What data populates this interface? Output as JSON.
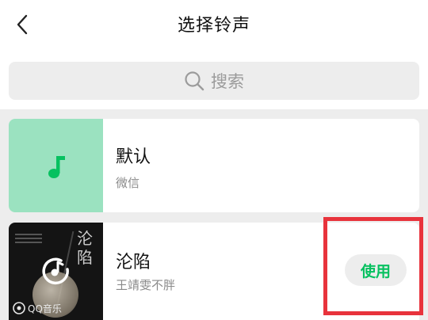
{
  "header": {
    "title": "选择铃声",
    "back_icon": "chevron-left-icon"
  },
  "search": {
    "placeholder": "搜索",
    "icon": "search-icon"
  },
  "ringtones": [
    {
      "name": "默认",
      "source": "微信",
      "thumb_color": "#9be2c0",
      "icon": "music-note-icon",
      "icon_color": "#07c160"
    },
    {
      "name": "沦陷",
      "artist": "王靖雯不胖",
      "artwork_text": "沦陷",
      "brand": "QQ音乐",
      "icon": "play-icon",
      "action_label": "使用"
    }
  ],
  "colors": {
    "accent": "#07c160",
    "highlight": "#e8333c",
    "background": "#ededed"
  }
}
